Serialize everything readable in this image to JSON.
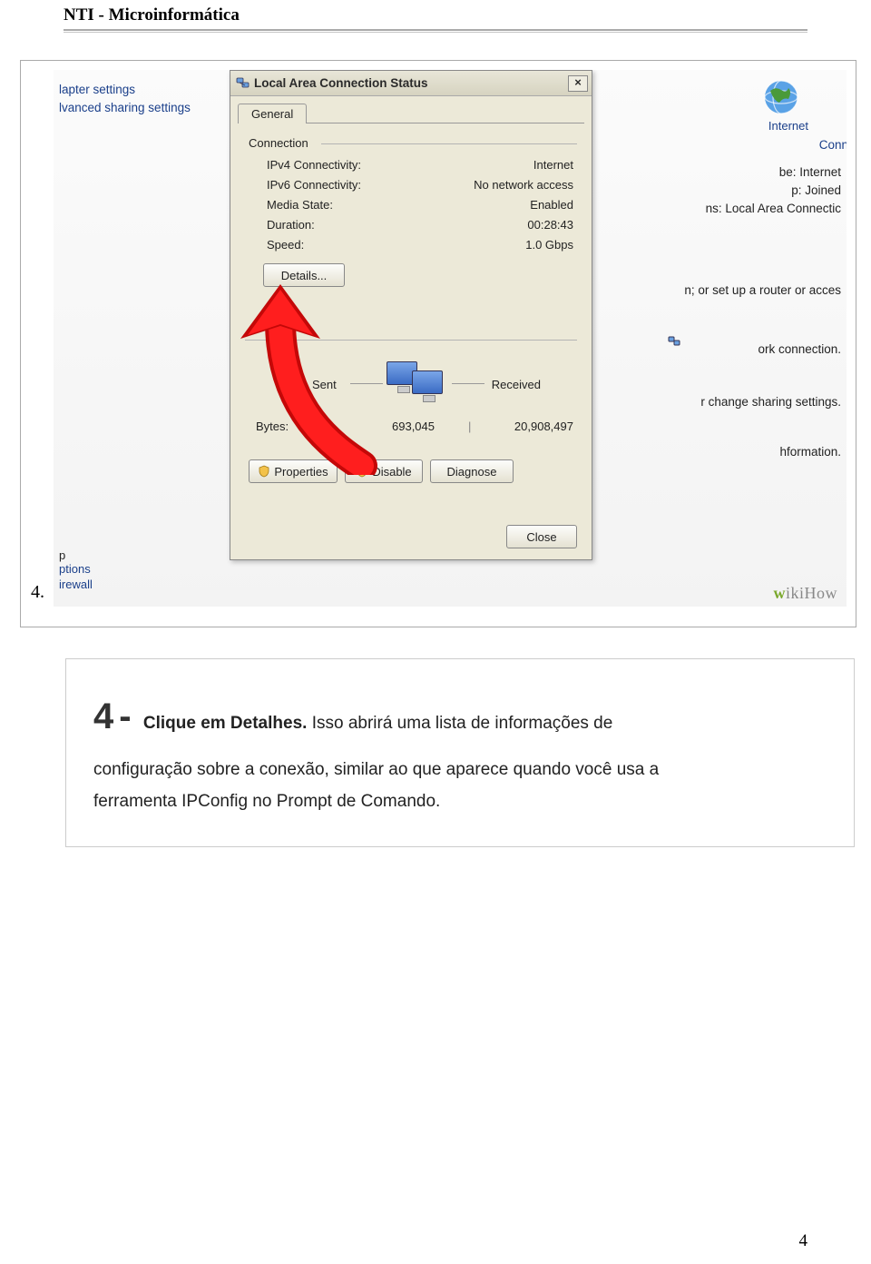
{
  "doc": {
    "header": "NTI - Microinformática",
    "page_number": "4"
  },
  "figure": {
    "step_marker": "4.",
    "left": {
      "l1": "lapter settings",
      "l2": "lvanced sharing settings",
      "p": "p",
      "bot1": "ptions",
      "bot2": "irewall"
    },
    "globe_label": "Internet",
    "right": {
      "conn": "Conn",
      "be": "be:    Internet",
      "p": "p:     Joined",
      "ns": "ns:      Local Area Connectic",
      "router": "n; or set up a router or acces",
      "ork": "ork connection.",
      "share": "r change sharing settings.",
      "info": "hformation."
    },
    "watermark": "wikiHow"
  },
  "dialog": {
    "title": "Local Area Connection Status",
    "close": "×",
    "tab_general": "General",
    "group_connection": "Connection",
    "rows": {
      "ipv4_k": "IPv4 Connectivity:",
      "ipv4_v": "Internet",
      "ipv6_k": "IPv6 Connectivity:",
      "ipv6_v": "No network access",
      "media_k": "Media State:",
      "media_v": "Enabled",
      "dur_k": "Duration:",
      "dur_v": "00:28:43",
      "speed_k": "Speed:",
      "speed_v": "1.0 Gbps"
    },
    "details_btn": "Details...",
    "activity": {
      "sent": "Sent",
      "received": "Received",
      "bytes_k": "Bytes:",
      "bytes_sent": "693,045",
      "bytes_recv": "20,908,497"
    },
    "properties_btn": "Properties",
    "disable_btn": "Disable",
    "diagnose_btn": "Diagnose",
    "close_btn": "Close"
  },
  "caption": {
    "big": "4",
    "dash": "-",
    "bold": "Clique em Detalhes.",
    "rest1": " Isso abrirá uma lista de informações de",
    "line2": "configuração sobre a conexão, similar ao que aparece quando você usa a",
    "line3": "ferramenta IPConfig no Prompt de Comando."
  }
}
